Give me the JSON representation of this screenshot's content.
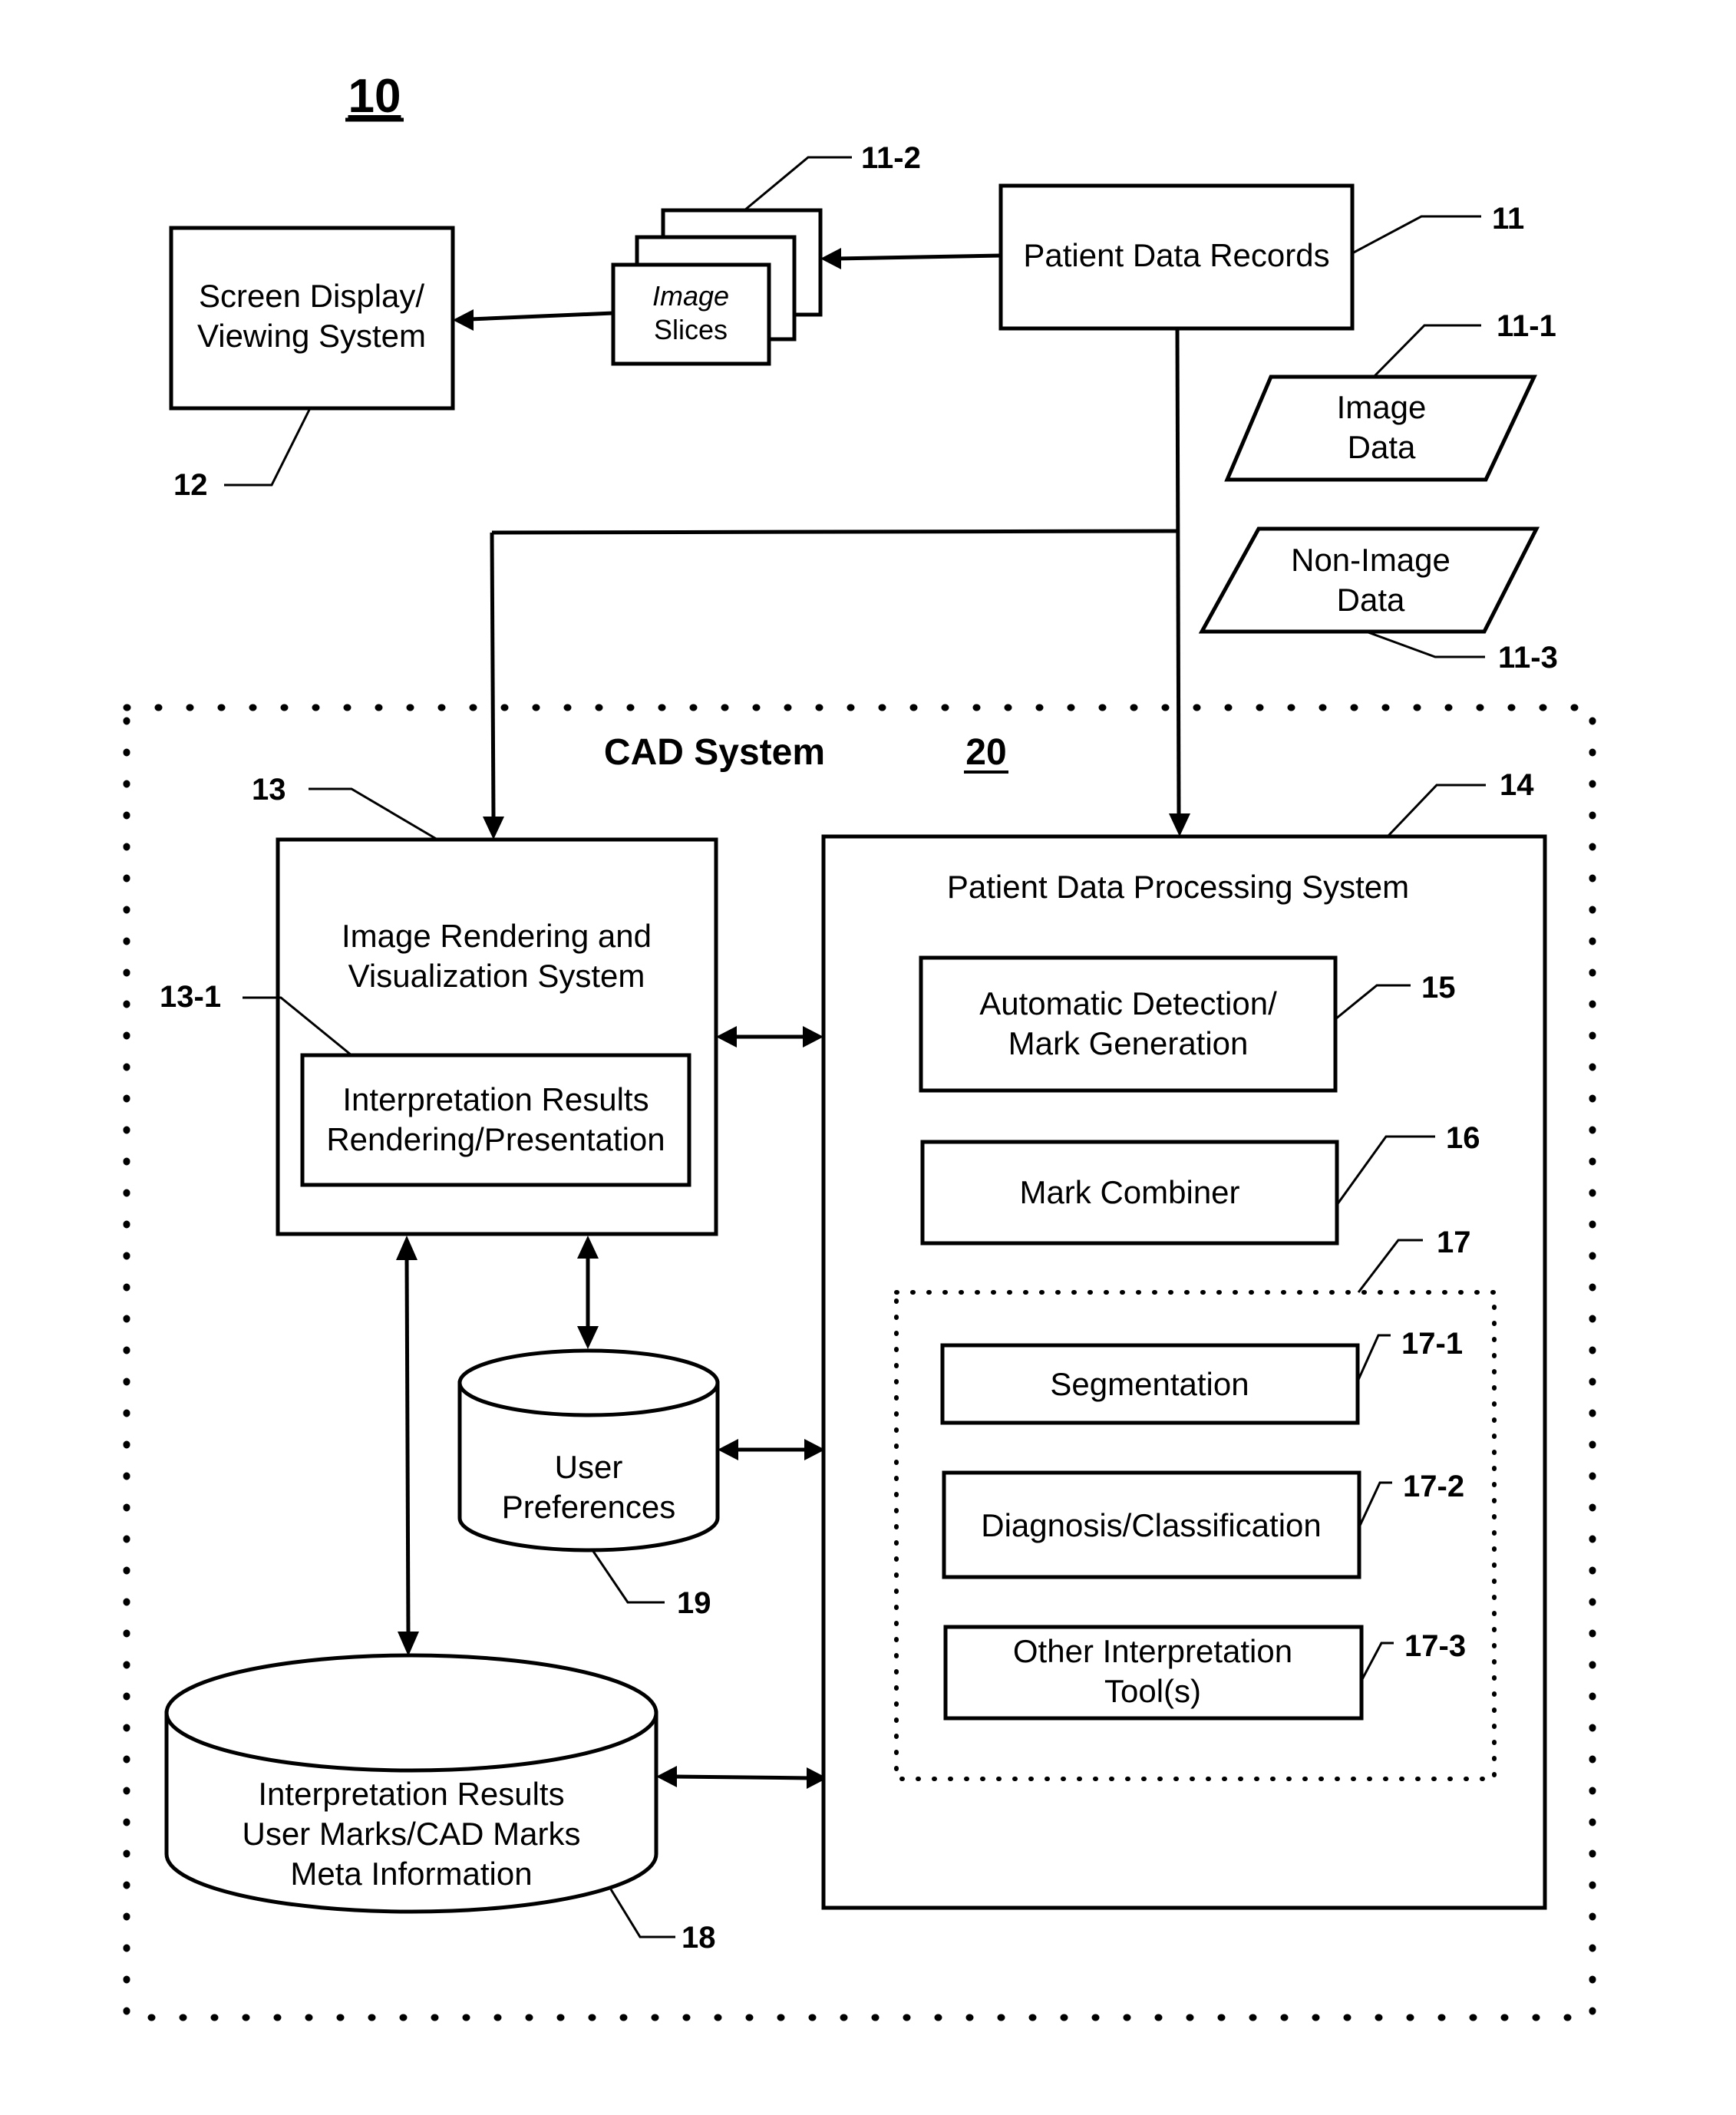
{
  "figure": {
    "number": "10",
    "cad_system": {
      "label": "CAD System",
      "number": "20"
    }
  },
  "nodes": {
    "screen_display": {
      "lines": [
        "Screen Display/",
        "Viewing System"
      ],
      "ref": "12"
    },
    "image_slices": {
      "lines": [
        "Image",
        "Slices"
      ],
      "ref": "11-2"
    },
    "patient_data_records": {
      "lines": [
        "Patient Data Records"
      ],
      "ref": "11"
    },
    "image_data": {
      "lines": [
        "Image",
        "Data"
      ],
      "ref": "11-1"
    },
    "non_image_data": {
      "lines": [
        "Non-Image",
        "Data"
      ],
      "ref": "11-3"
    },
    "image_rendering": {
      "lines": [
        "Image Rendering and",
        "Visualization System"
      ],
      "ref": "13"
    },
    "interp_rendering": {
      "lines": [
        "Interpretation Results",
        "Rendering/Presentation"
      ],
      "ref": "13-1"
    },
    "patient_data_processing": {
      "lines": [
        "Patient Data Processing System"
      ],
      "ref": "14"
    },
    "auto_detection": {
      "lines": [
        "Automatic Detection/",
        "Mark Generation"
      ],
      "ref": "15"
    },
    "mark_combiner": {
      "lines": [
        "Mark Combiner"
      ],
      "ref": "16"
    },
    "interp_tools_group": {
      "ref": "17"
    },
    "segmentation": {
      "lines": [
        "Segmentation"
      ],
      "ref": "17-1"
    },
    "diagnosis": {
      "lines": [
        "Diagnosis/Classification"
      ],
      "ref": "17-2"
    },
    "other_tools": {
      "lines": [
        "Other Interpretation",
        "Tool(s)"
      ],
      "ref": "17-3"
    },
    "interp_results_db": {
      "lines": [
        "Interpretation Results",
        "User Marks/CAD Marks",
        "Meta Information"
      ],
      "ref": "18"
    },
    "user_preferences_db": {
      "lines": [
        "User",
        "Preferences"
      ],
      "ref": "19"
    }
  }
}
